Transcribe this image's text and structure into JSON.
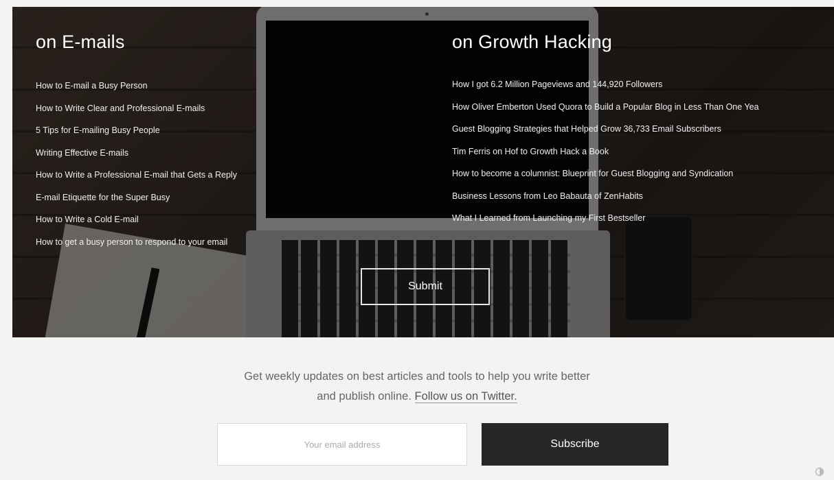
{
  "hero": {
    "left_column": {
      "heading": "on E-mails",
      "links": [
        "How to E-mail a Busy Person",
        "How to Write Clear and Professional E-mails",
        "5 Tips for E-mailing Busy People",
        "Writing Effective E-mails",
        "How to Write a Professional E-mail that Gets a Reply",
        "E-mail Etiquette for the Super Busy",
        "How to Write a Cold E-mail",
        "How to get a busy person to respond to your email"
      ]
    },
    "right_column": {
      "heading": "on Growth Hacking",
      "links": [
        "How I got 6.2 Million Pageviews and 144,920 Followers",
        "How Oliver Emberton Used Quora to Build a Popular Blog in Less Than One Yea",
        "Guest Blogging Strategies that Helped Grow 36,733 Email Subscribers",
        "Tim Ferris on Hof to Growth Hack a Book",
        "How to become a columnist: Blueprint for Guest Blogging and Syndication",
        "Business Lessons from Leo Babauta of ZenHabits",
        "What I Learned from Launching my First Bestseller"
      ]
    },
    "submit_label": "Submit"
  },
  "newsletter": {
    "line1": "Get weekly updates on best articles and tools to help you write better",
    "line2_prefix": "and publish online.",
    "twitter_link": "Follow us on Twitter.",
    "email_placeholder": "Your email address",
    "subscribe_label": "Subscribe"
  },
  "icons": {
    "corner": "loading-icon"
  }
}
